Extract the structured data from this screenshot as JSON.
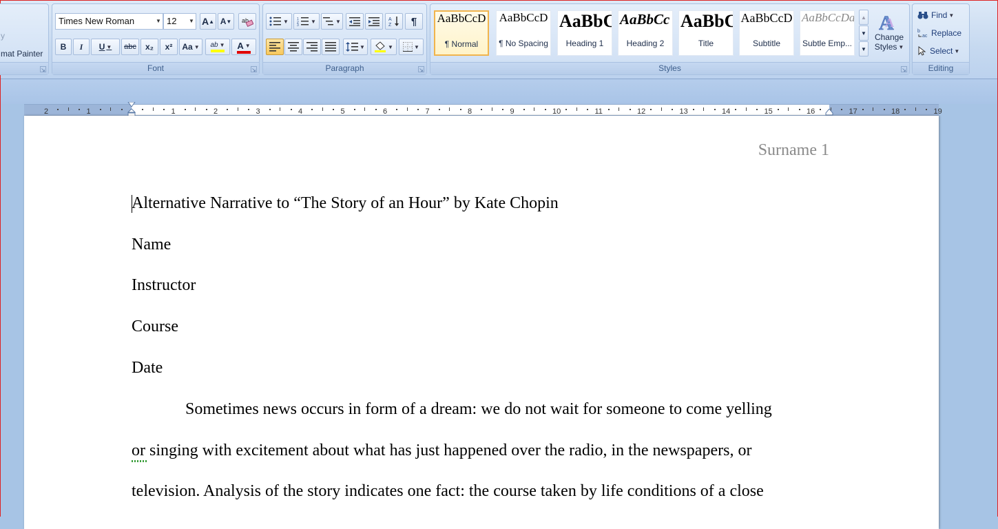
{
  "clipboard": {
    "format_painter_label": "mat Painter",
    "left_fragment": "y"
  },
  "font": {
    "group_label": "Font",
    "family": "Times New Roman",
    "size": "12",
    "grow_icon": "A",
    "shrink_icon": "A",
    "bold": "B",
    "italic": "I",
    "underline": "U",
    "strike": "abc",
    "subscript": "x₂",
    "superscript": "x²",
    "change_case": "Aa",
    "highlight": "ab",
    "font_color": "A",
    "highlight_color": "#ffff00",
    "font_color_value": "#e00000"
  },
  "paragraph": {
    "group_label": "Paragraph",
    "show_marks": "¶"
  },
  "styles": {
    "group_label": "Styles",
    "tiles": [
      {
        "sample": "AaBbCcD",
        "name": "¶ Normal"
      },
      {
        "sample": "AaBbCcD",
        "name": "¶ No Spacing"
      },
      {
        "sample": "AaBbC",
        "name": "Heading 1"
      },
      {
        "sample": "AaBbCc",
        "name": "Heading 2"
      },
      {
        "sample": "AaBbC",
        "name": "Title"
      },
      {
        "sample": "AaBbCcD",
        "name": "Subtitle"
      },
      {
        "sample": "AaBbCcDa",
        "name": "Subtle Emp..."
      }
    ],
    "change_styles_line1": "Change",
    "change_styles_line2": "Styles"
  },
  "editing": {
    "group_label": "Editing",
    "find": "Find",
    "replace": "Replace",
    "select": "Select"
  },
  "ruler": {
    "left_labels": [
      "2",
      "1"
    ],
    "right_labels": [
      "1",
      "2",
      "3",
      "4",
      "5",
      "6",
      "7",
      "8",
      "9",
      "10",
      "11",
      "12",
      "13",
      "14",
      "15",
      "16",
      "17",
      "18",
      "19"
    ]
  },
  "document": {
    "header": "Surname 1",
    "title": "Alternative Narrative to “The Story of an Hour” by Kate Chopin",
    "name": "Name",
    "instructor": "Instructor",
    "course": "Course",
    "date": "Date",
    "body_lines": [
      "Sometimes news occurs in form of a dream: we do not wait for someone to come yelling",
      "or singing with excitement about what has just happened over the radio, in the newspapers, or",
      "television. Analysis of the story indicates one fact: the course taken by life conditions of a close"
    ]
  },
  "colors": {
    "accent": "#f1b44c",
    "ribbon": "#c6d9f0",
    "workspace": "#a7c4e5"
  }
}
